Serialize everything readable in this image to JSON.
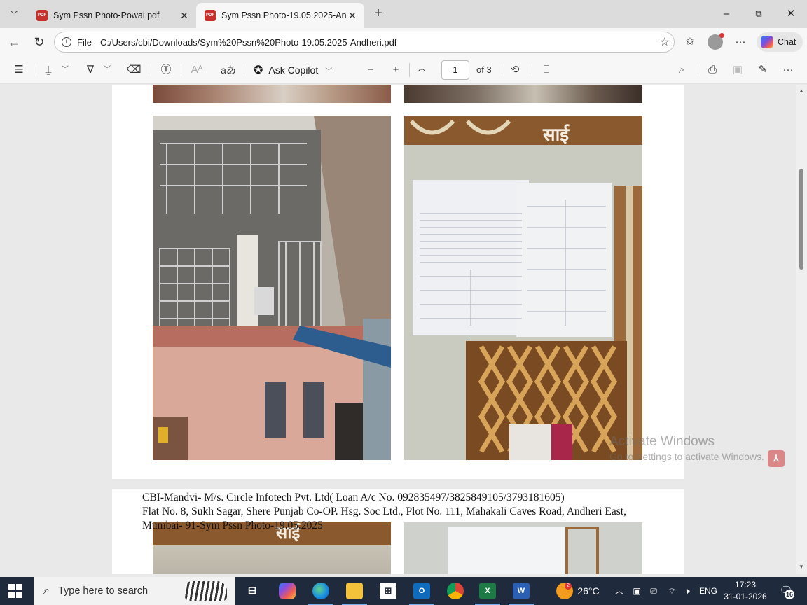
{
  "browser": {
    "tabs": [
      {
        "title": "Sym Pssn Photo-Powai.pdf",
        "active": false
      },
      {
        "title": "Sym Pssn Photo-19.05.2025-Andheri.pdf",
        "active": true
      }
    ],
    "address": {
      "scheme": "File",
      "url": "C:/Users/cbi/Downloads/Sym%20Pssn%20Photo-19.05.2025-Andheri.pdf"
    },
    "chat_label": "Chat",
    "pdf_icon_text": "PDF"
  },
  "pdf_toolbar": {
    "ask_copilot": "Ask Copilot",
    "current_page": "1",
    "page_total": "of 3",
    "read_aloud_glyph": "aあ"
  },
  "document": {
    "photo_sign_text": "साई",
    "caption": {
      "line1": "CBI-Mandvi- M/s. Circle Infotech Pvt. Ltd( Loan A/c No. 092835497/3825849105/3793181605)",
      "line2": "Flat No. 8, Sukh Sagar, Shere Punjab Co-OP. Hsg. Soc Ltd., Plot No. 111, Mahakali Caves Road, Andheri East,",
      "line3": "Mumbai- 91-Sym Pssn Photo-19.05.2025"
    }
  },
  "watermark": {
    "title": "Activate Windows",
    "subtitle": "Go to Settings to activate Windows."
  },
  "taskbar": {
    "search_placeholder": "Type here to search",
    "weather": "26°C",
    "language": "ENG",
    "time": "17:23",
    "date": "31-01-2026",
    "notification_count": "16",
    "weather_badge": "2"
  },
  "colors": {
    "tab_bar": "#dcdcdc",
    "toolbar": "#f7f7f7",
    "viewer_bg": "#e9e9e9",
    "taskbar": "#1f2a3c",
    "pdf_icon": "#c8302b"
  },
  "icons": [
    "tab-list-icon",
    "pdf-icon",
    "close-icon",
    "plus-icon",
    "minimize-icon",
    "maximize-icon",
    "back-arrow-icon",
    "refresh-icon",
    "info-icon",
    "star-icon",
    "favorites-icon",
    "profile-icon",
    "more-icon",
    "copilot-icon",
    "contents-icon",
    "highlight-icon",
    "draw-icon",
    "eraser-icon",
    "text-icon",
    "read-aloud-icon",
    "translate-icon",
    "zoom-out-icon",
    "zoom-in-icon",
    "fit-page-icon",
    "rotate-icon",
    "page-view-icon",
    "search-icon",
    "print-icon",
    "save-icon",
    "save-as-icon",
    "windows-start-icon",
    "task-view-icon",
    "edge-icon",
    "file-explorer-icon",
    "store-icon",
    "outlook-icon",
    "chrome-icon",
    "excel-icon",
    "word-icon",
    "weather-icon",
    "notification-icon"
  ]
}
